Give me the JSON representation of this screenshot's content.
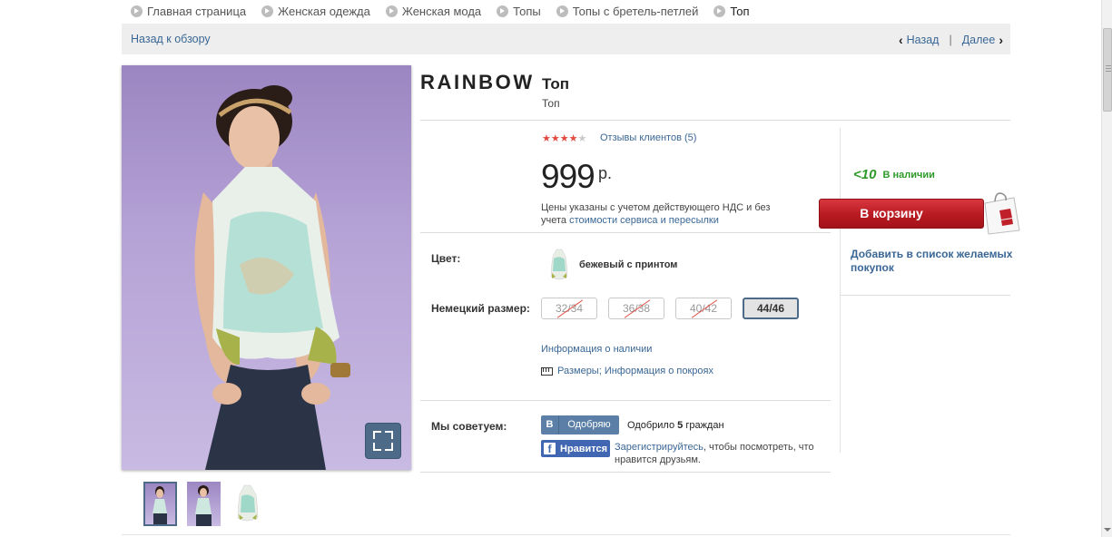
{
  "breadcrumb": [
    "Главная страница",
    "Женская одежда",
    "Женская мода",
    "Топы",
    "Топы с бретель-петлей",
    "Топ"
  ],
  "nav": {
    "back": "Назад к обзору",
    "prev": "Назад",
    "separator": "|",
    "next": "Далее"
  },
  "product": {
    "brand": "RAINBOW",
    "title": "Топ",
    "subtitle": "Топ",
    "rating": 4,
    "rating_max": 5,
    "reviews_link": "Отзывы клиентов (5)",
    "price": "999",
    "currency": "р.",
    "price_note_pre": "Цены указаны с учетом действующего НДС и без учета ",
    "price_note_link": "стоимости сервиса и пересылки",
    "color_label": "Цвет:",
    "color_value": "бежевый с принтом",
    "size_label": "Немецкий размер:",
    "sizes": [
      {
        "label": "32/34",
        "available": false
      },
      {
        "label": "36/38",
        "available": false
      },
      {
        "label": "40/42",
        "available": false
      },
      {
        "label": "44/46",
        "available": true,
        "selected": true
      }
    ],
    "availability_link": "Информация о наличии",
    "size_info_link": "Размеры; Информация о покроях"
  },
  "buy": {
    "stock_qty": "<10",
    "stock_text": "В наличии",
    "cart_button": "В корзину",
    "wishlist_link": "Добавить в список желаемых покупок"
  },
  "social": {
    "label": "Мы советуем:",
    "vk_icon": "В",
    "vk_button": "Одобряю",
    "vk_text_pre": "Одобрило ",
    "vk_count": "5",
    "vk_text_post": " граждан",
    "fb_icon": "f",
    "fb_button": "Нравится",
    "fb_link": "Зарегистрируйтесь",
    "fb_text": ", чтобы посмотреть, что нравится друзьям."
  },
  "colors": {
    "link": "#3a6795",
    "cart": "#c0202a",
    "stock": "#2e9a2a",
    "star_on": "#e04a3f",
    "selected_border": "#4d6b88"
  }
}
